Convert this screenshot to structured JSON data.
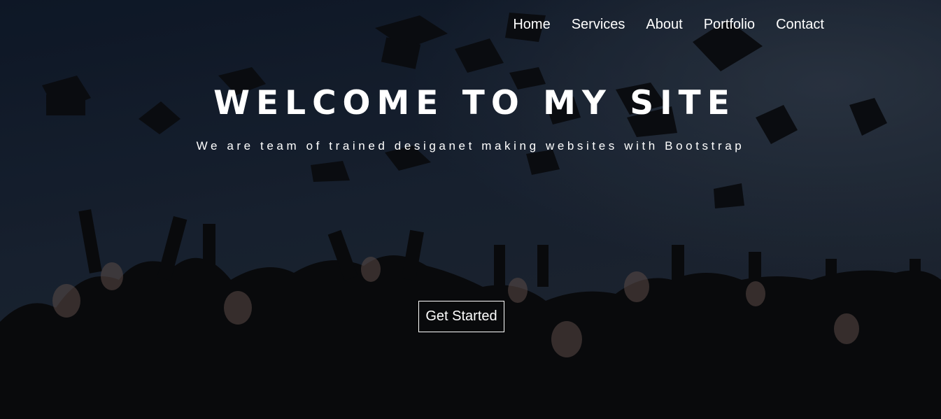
{
  "nav": {
    "items": [
      {
        "label": "Home"
      },
      {
        "label": "Services"
      },
      {
        "label": "About"
      },
      {
        "label": "Portfolio"
      },
      {
        "label": "Contact"
      }
    ]
  },
  "hero": {
    "title": "WELCOME TO MY SITE",
    "subtitle": "We are team of trained desiganet making websites with Bootstrap",
    "cta_label": "Get Started",
    "background_image": "graduates-throwing-caps-icon"
  },
  "colors": {
    "text": "#ffffff",
    "sky_dark": "#121d2e",
    "sky_light": "#2a3442",
    "gown": "#0b0b0d"
  }
}
